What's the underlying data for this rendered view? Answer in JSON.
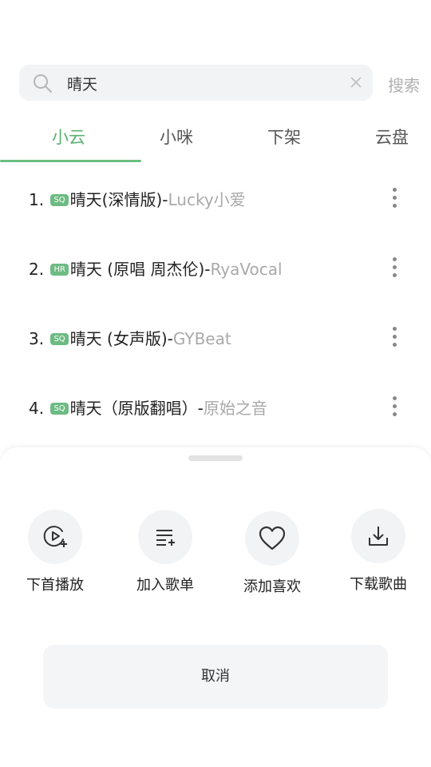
{
  "search": {
    "query": "晴天",
    "button": "搜索"
  },
  "tabs": [
    {
      "label": "小云"
    },
    {
      "label": "小咪"
    },
    {
      "label": "下架"
    },
    {
      "label": "云盘"
    }
  ],
  "results": [
    {
      "index": "1.",
      "badge": "SQ",
      "title": "晴天(深情版)-",
      "artist": "Lucky小爱"
    },
    {
      "index": "2.",
      "badge": "HR",
      "title": "晴天 (原唱 周杰伦)-",
      "artist": "RyaVocal"
    },
    {
      "index": "3.",
      "badge": "SQ",
      "title": "晴天 (女声版)-",
      "artist": "GYBeat"
    },
    {
      "index": "4.",
      "badge": "SQ",
      "title": "晴天（原版翻唱）-",
      "artist": "原始之音"
    }
  ],
  "sheet": {
    "actions": [
      {
        "label": "下首播放",
        "icon": "play-next-icon"
      },
      {
        "label": "加入歌单",
        "icon": "add-to-playlist-icon"
      },
      {
        "label": "添加喜欢",
        "icon": "heart-icon"
      },
      {
        "label": "下载歌曲",
        "icon": "download-icon"
      }
    ],
    "cancel": "取消"
  },
  "colors": {
    "accent": "#5cb070",
    "badge": "#6dbb83",
    "artist": "#a9a9a9"
  }
}
